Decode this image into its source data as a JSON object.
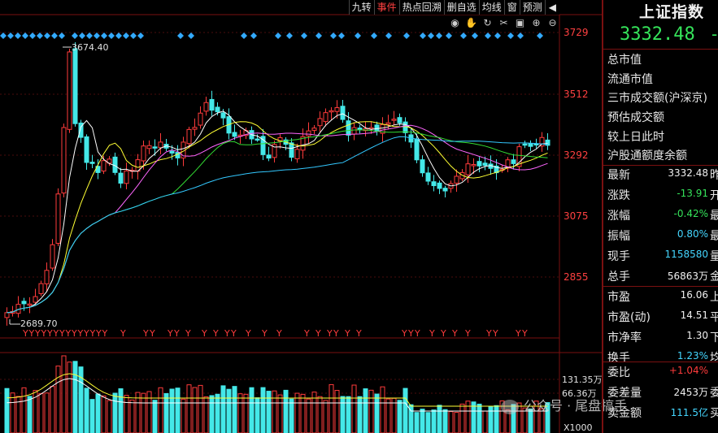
{
  "toolbar": {
    "items": [
      "九转",
      "事件",
      "热点回溯",
      "删自选",
      "均线",
      "窗",
      "预测"
    ],
    "active_index": 1,
    "arrow": "◀"
  },
  "tools": [
    "eye-icon",
    "hand-icon",
    "refresh-icon",
    "scissors-icon",
    "delete-icon",
    "zoom-in-icon",
    "zoom-out-icon"
  ],
  "price_axis": {
    "labels": [
      "3729",
      "3512",
      "3292",
      "3075",
      "2855"
    ],
    "max_label": "3674.40",
    "min_label": "2689.70"
  },
  "volume_axis": {
    "labels": [
      "131.35万",
      "66.36万"
    ],
    "unit": "X1000"
  },
  "colors": {
    "up": "#ff3b3b",
    "down": "#44e8e8",
    "ma5": "#ffffff",
    "ma10": "#ffff33",
    "ma20": "#ff66ff",
    "ma30": "#33dd33",
    "ma60": "#33c8ff",
    "marker": "#33aaff"
  },
  "y_marker": "Y",
  "header": {
    "index_name": "上证指数",
    "price": "3332.48",
    "extra": "-"
  },
  "meta": [
    "总市值",
    "流通市值",
    "三市成交额(沪深京)",
    "预估成交额",
    "较上日此时",
    "沪股通额度余额"
  ],
  "quote": {
    "rows": [
      {
        "label": "最新",
        "value": "3332.48",
        "unit": "昨",
        "cls": "white"
      },
      {
        "label": "涨跌",
        "value": "-13.91",
        "unit": "开",
        "cls": "green"
      },
      {
        "label": "涨幅",
        "value": "-0.42%",
        "unit": "最",
        "cls": "green"
      },
      {
        "label": "振幅",
        "value": "0.80%",
        "unit": "最",
        "cls": "cyan"
      },
      {
        "label": "现手",
        "value": "1158580",
        "unit": "量",
        "cls": "cyan"
      },
      {
        "label": "总手",
        "value": "56863万",
        "unit": "金",
        "cls": "white"
      }
    ],
    "rows2": [
      {
        "label": "市盈",
        "value": "16.06",
        "unit": "上",
        "cls": "white"
      },
      {
        "label": "市盈(动)",
        "value": "14.51",
        "unit": "平",
        "cls": "white"
      },
      {
        "label": "市净率",
        "value": "1.30",
        "unit": "下",
        "cls": "white"
      },
      {
        "label": "换手",
        "value": "1.23%",
        "unit": "均",
        "cls": "cyan"
      }
    ],
    "rows3": [
      {
        "label": "委比",
        "value": "+1.04%",
        "unit": "",
        "cls": "red"
      },
      {
        "label": "委差量",
        "value": "2453万",
        "unit": "委",
        "cls": "white"
      },
      {
        "label": "卖金额",
        "value": "111.5亿",
        "unit": "买",
        "cls": "cyan"
      }
    ]
  },
  "watermark": "公众号 · 尾盘搞手"
}
